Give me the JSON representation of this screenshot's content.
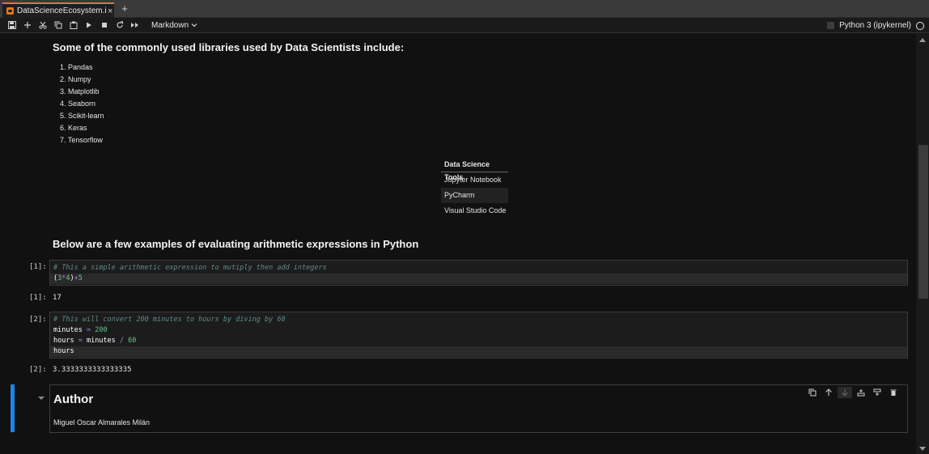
{
  "tab": {
    "label": "DataScienceEcosystem.ipynb",
    "close": "×",
    "new": "+"
  },
  "toolbar": {
    "icons": [
      "save-icon",
      "add-icon",
      "cut-icon",
      "copy-icon",
      "paste-icon",
      "run-icon",
      "stop-icon",
      "restart-icon",
      "run-all-icon"
    ],
    "cell_type": "Markdown",
    "kernel": "Python 3 (ipykernel)"
  },
  "section1": {
    "heading": "Some of the commonly used libraries used by Data Scientists include:",
    "libraries": [
      "1. Pandas",
      "2. Numpy",
      "3. Matplotlib",
      "4. Seaborn",
      "5. Scikit-learn",
      "6. Keras",
      "7. Tensorflow"
    ]
  },
  "tools_table": {
    "header": "Data Science Tools",
    "rows": [
      "Jupyter Notebook",
      "PyCharm",
      "Visual Studio Code"
    ]
  },
  "section2": {
    "heading": "Below are a few examples of evaluating arithmetic expressions in Python"
  },
  "cell1": {
    "prompt": "[1]:",
    "comment": "# This a simple arithmetic expression to mutiply then add integers",
    "output_prompt": "[1]:",
    "output": "17"
  },
  "cell2": {
    "prompt": "[2]:",
    "comment": "# This will convert 200 minutes to hours by diving by 60",
    "output_prompt": "[2]:",
    "output": "3.3333333333333335"
  },
  "author": {
    "title": "Author",
    "name": "Miguel Oscar Almarales Milán"
  },
  "colors": {
    "accent": "#1a84e8",
    "tab_accent": "#e07a1f",
    "background": "#111111"
  }
}
